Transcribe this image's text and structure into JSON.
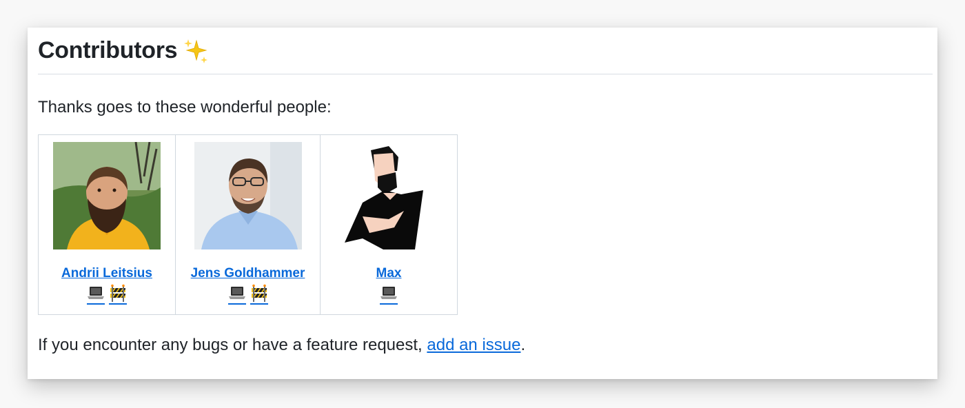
{
  "section": {
    "title": "Contributors",
    "title_emoji_icon": "sparkles-icon",
    "intro": "Thanks goes to these wonderful people:",
    "outro_before_link": "If you encounter any bugs or have a feature request, ",
    "outro_link_label": "add an issue",
    "outro_after_link": "."
  },
  "contributors": [
    {
      "name": "Andrii Leitsius",
      "avatar_icon": "avatar-photo-bearded-man-yellow-jacket",
      "badges": [
        "laptop-icon",
        "construction-barrier-icon"
      ]
    },
    {
      "name": "Jens Goldhammer",
      "avatar_icon": "avatar-photo-man-glasses-blue-shirt",
      "badges": [
        "laptop-icon",
        "construction-barrier-icon"
      ]
    },
    {
      "name": "Max",
      "avatar_icon": "avatar-illustration-bearded-figure",
      "badges": [
        "laptop-icon"
      ]
    }
  ],
  "colors": {
    "link": "#0969da",
    "text": "#1f2328",
    "border": "#d0d7de",
    "divider": "#d8dee4"
  }
}
